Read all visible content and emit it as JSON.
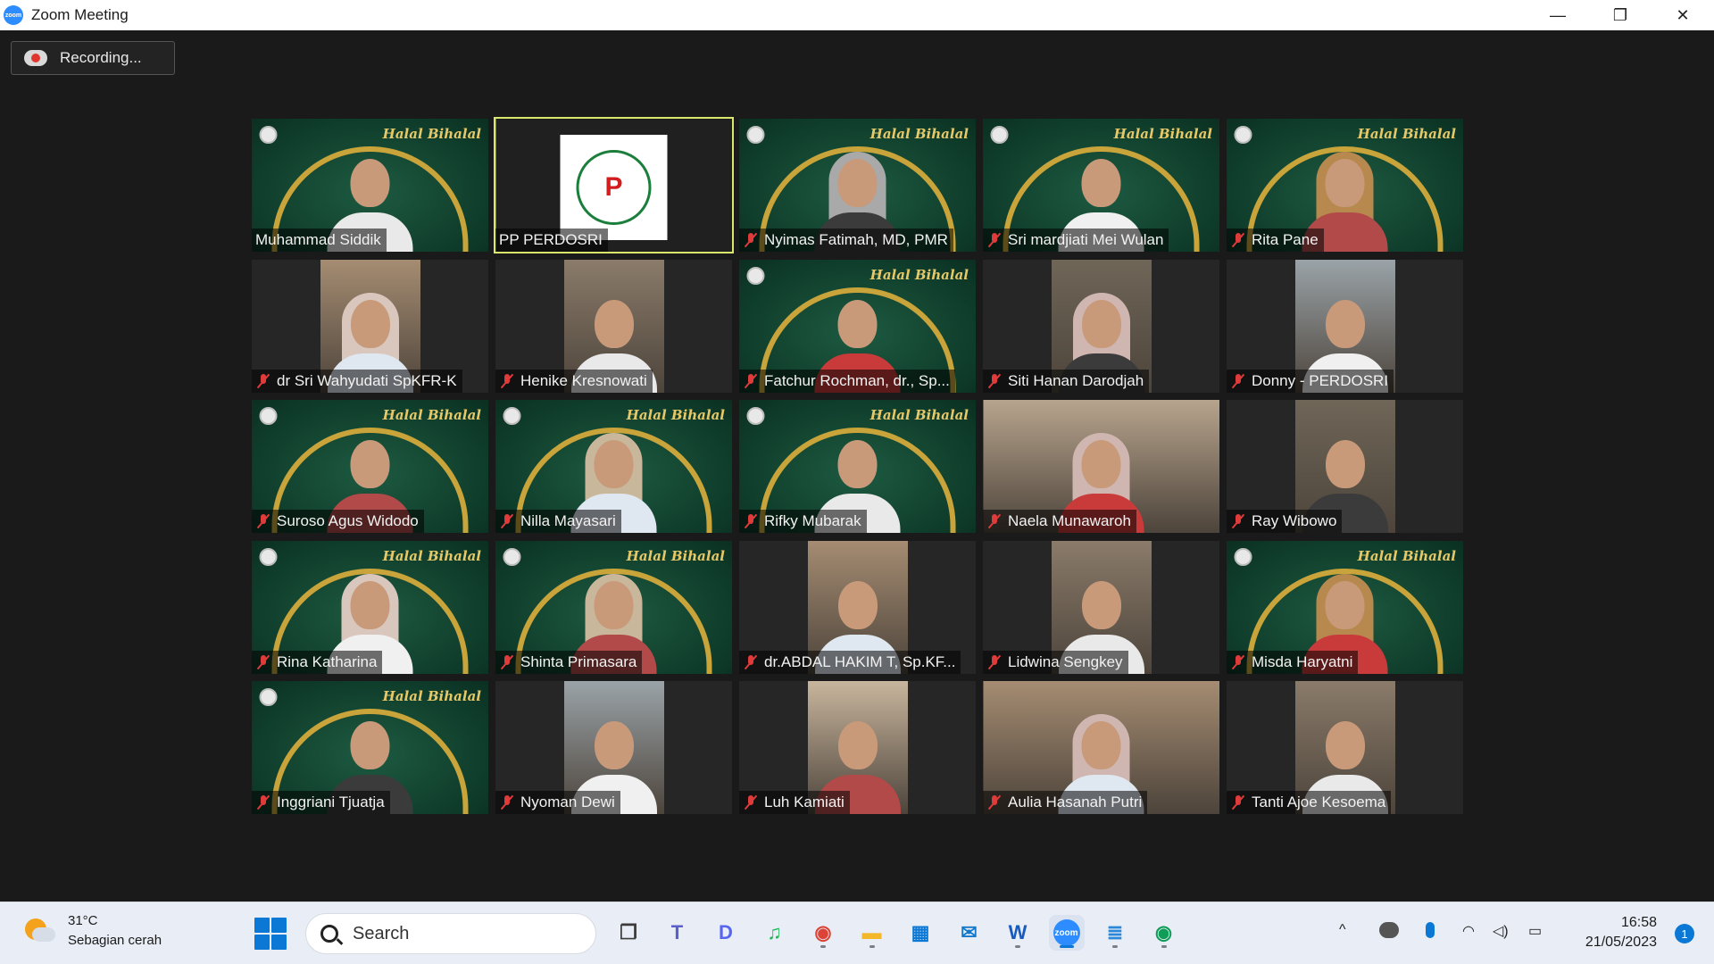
{
  "window": {
    "title": "Zoom Meeting",
    "app_icon_label": "zoom",
    "controls": {
      "minimize": "—",
      "restore": "❐",
      "close": "✕"
    }
  },
  "recording": {
    "label": "Recording...",
    "indicator_color": "#e0362d"
  },
  "background_text": {
    "halal": "Halal Bihalal"
  },
  "participants": [
    {
      "name": "Muhammad Siddik",
      "muted": false,
      "active_speaker": false,
      "video": "halal-bihalal"
    },
    {
      "name": "PP PERDOSRI",
      "muted": false,
      "active_speaker": true,
      "video": "logo",
      "logo_text": "P"
    },
    {
      "name": "Nyimas Fatimah, MD, PMR",
      "muted": true,
      "active_speaker": false,
      "video": "halal-bihalal"
    },
    {
      "name": "Sri mardjiati Mei Wulan",
      "muted": true,
      "active_speaker": false,
      "video": "halal-bihalal"
    },
    {
      "name": "Rita Pane",
      "muted": true,
      "active_speaker": false,
      "video": "halal-bihalal"
    },
    {
      "name": "dr Sri Wahyudati SpKFR-K",
      "muted": true,
      "active_speaker": false,
      "video": "camera"
    },
    {
      "name": "Henike Kresnowati",
      "muted": true,
      "active_speaker": false,
      "video": "camera"
    },
    {
      "name": "Fatchur Rochman, dr., Sp...",
      "muted": true,
      "active_speaker": false,
      "video": "halal-bihalal"
    },
    {
      "name": "Siti Hanan Darodjah",
      "muted": true,
      "active_speaker": false,
      "video": "camera"
    },
    {
      "name": "Donny - PERDOSRI",
      "muted": true,
      "active_speaker": false,
      "video": "camera"
    },
    {
      "name": "Suroso Agus Widodo",
      "muted": true,
      "active_speaker": false,
      "video": "halal-bihalal"
    },
    {
      "name": "Nilla Mayasari",
      "muted": true,
      "active_speaker": false,
      "video": "halal-bihalal"
    },
    {
      "name": "Rifky Mubarak",
      "muted": true,
      "active_speaker": false,
      "video": "halal-bihalal"
    },
    {
      "name": "Naela Munawaroh",
      "muted": true,
      "active_speaker": false,
      "video": "camera-wide"
    },
    {
      "name": "Ray Wibowo",
      "muted": true,
      "active_speaker": false,
      "video": "camera"
    },
    {
      "name": "Rina Katharina",
      "muted": true,
      "active_speaker": false,
      "video": "halal-bihalal"
    },
    {
      "name": "Shinta Primasara",
      "muted": true,
      "active_speaker": false,
      "video": "halal-bihalal"
    },
    {
      "name": "dr.ABDAL HAKIM T, Sp.KF...",
      "muted": true,
      "active_speaker": false,
      "video": "camera"
    },
    {
      "name": "Lidwina Sengkey",
      "muted": true,
      "active_speaker": false,
      "video": "camera"
    },
    {
      "name": "Misda Haryatni",
      "muted": true,
      "active_speaker": false,
      "video": "halal-bihalal"
    },
    {
      "name": "Inggriani Tjuatja",
      "muted": true,
      "active_speaker": false,
      "video": "halal-bihalal"
    },
    {
      "name": "Nyoman Dewi",
      "muted": true,
      "active_speaker": false,
      "video": "camera"
    },
    {
      "name": "Luh Kamiati",
      "muted": true,
      "active_speaker": false,
      "video": "camera"
    },
    {
      "name": "Aulia Hasanah Putri",
      "muted": true,
      "active_speaker": false,
      "video": "camera-wide"
    },
    {
      "name": "Tanti Ajoe Kesoema",
      "muted": true,
      "active_speaker": false,
      "video": "camera"
    }
  ],
  "taskbar": {
    "weather": {
      "temp": "31°C",
      "condition": "Sebagian cerah"
    },
    "search_placeholder": "Search",
    "apps": [
      {
        "name": "task-view",
        "glyph": "❐",
        "color": "#3b3b3b"
      },
      {
        "name": "teams",
        "glyph": "T",
        "color": "#5b5fc7"
      },
      {
        "name": "discord",
        "glyph": "D",
        "color": "#5865f2"
      },
      {
        "name": "spotify",
        "glyph": "♫",
        "color": "#1db954"
      },
      {
        "name": "chrome",
        "glyph": "◉",
        "color": "#db4437"
      },
      {
        "name": "file-explorer",
        "glyph": "▬",
        "color": "#f2b72b"
      },
      {
        "name": "microsoft-store",
        "glyph": "▦",
        "color": "#0a78d4"
      },
      {
        "name": "mail",
        "glyph": "✉",
        "color": "#1479c9"
      },
      {
        "name": "word",
        "glyph": "W",
        "color": "#185abd"
      },
      {
        "name": "zoom",
        "glyph": "zoom",
        "color": "#2d8cff"
      },
      {
        "name": "notepad",
        "glyph": "≣",
        "color": "#2b88d8"
      },
      {
        "name": "chrome-profile",
        "glyph": "◉",
        "color": "#0f9d58"
      }
    ],
    "tray": {
      "chevron": "^",
      "wifi": "◠",
      "volume": "◁)",
      "battery": "▭"
    },
    "clock": {
      "time": "16:58",
      "date": "21/05/2023"
    },
    "notification_count": "1"
  }
}
